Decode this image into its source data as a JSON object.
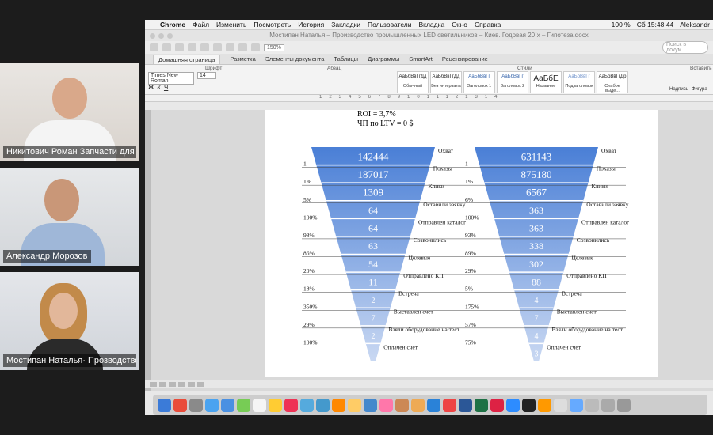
{
  "video_tiles": [
    {
      "name": "Никитович Роман Запчасти для ре..."
    },
    {
      "name": "Александр Морозов"
    },
    {
      "name": "Мостипан Наталья· Прозводство ..."
    }
  ],
  "menubar": {
    "apple": "",
    "items": [
      "Chrome",
      "Файл",
      "Изменить",
      "Посмотреть",
      "История",
      "Закладки",
      "Пользователи",
      "Вкладка",
      "Окно",
      "Справка"
    ],
    "battery": "100 %",
    "clock": "Сб 15:48:44",
    "user": "Aleksandr"
  },
  "window": {
    "title": "Мостипан Наталья – Производство промышленных LED светильников – Киев. Годовая 20`х – Гипотеза.docx",
    "zoom": "150%",
    "search_placeholder": "Поиск в докум..."
  },
  "ribbon": {
    "tabs": [
      "Домашняя страница",
      "Разметка",
      "Элементы документа",
      "Таблицы",
      "Диаграммы",
      "SmartArt",
      "Рецензирование"
    ],
    "groups": {
      "font": "Шрифт",
      "paragraph": "Абзац",
      "styles": "Стили",
      "insert": "Вставить"
    },
    "font_name": "Times New Roman",
    "font_size": "14",
    "styles": [
      {
        "preview": "АаБбВвГгДд",
        "label": "Обычный"
      },
      {
        "preview": "АаБбВвГгДд",
        "label": "Без интервала"
      },
      {
        "preview": "АаБбВвГг",
        "label": "Заголовок 1"
      },
      {
        "preview": "АаБбВвГг",
        "label": "Заголовок 2"
      },
      {
        "preview": "АаБбЕ",
        "label": "Название"
      },
      {
        "preview": "АаБбВвГг",
        "label": "Подзаголовок"
      },
      {
        "preview": "АаБбВвГгДр",
        "label": "Слабое выде..."
      }
    ],
    "right_labels": [
      "Надпись",
      "Фигура"
    ]
  },
  "document": {
    "roi": "ROI = 3,7%",
    "npv": "ЧП по LTV = 0 $"
  },
  "funnel_left": {
    "values": [
      "142444",
      "187017",
      "1309",
      "64",
      "64",
      "63",
      "54",
      "11",
      "2",
      "7",
      "2",
      ""
    ],
    "stages": [
      "Охват",
      "Показы",
      "Клики",
      "Оставили заявку",
      "Отправлен каталог",
      "Созвонились",
      "Целевые",
      "Отправлено КП",
      "Встреча",
      "Выставлен счет",
      "Взяли оборудование на тест",
      "Оплачен счет"
    ],
    "percents": [
      "1",
      "1%",
      "5%",
      "100%",
      "98%",
      "86%",
      "20%",
      "18%",
      "350%",
      "29%",
      "100%"
    ]
  },
  "funnel_right": {
    "values": [
      "631143",
      "875180",
      "6567",
      "363",
      "363",
      "338",
      "302",
      "88",
      "4",
      "7",
      "4",
      "3"
    ],
    "stages": [
      "Охват",
      "Показы",
      "Клики",
      "Оставили заявку",
      "Отправлен каталог",
      "Созвонились",
      "Целевые",
      "Отправлено КП",
      "Встреча",
      "Выставлен счет",
      "Взяли оборудование на тест",
      "Оплачен счет"
    ],
    "percents": [
      "1",
      "1%",
      "6%",
      "100%",
      "93%",
      "89%",
      "29%",
      "5%",
      "175%",
      "57%",
      "75%"
    ]
  },
  "colors": {
    "funnel_top": "#4a7fd6",
    "funnel_bottom": "#c9d8f2",
    "active_tile": "#23c98a"
  }
}
